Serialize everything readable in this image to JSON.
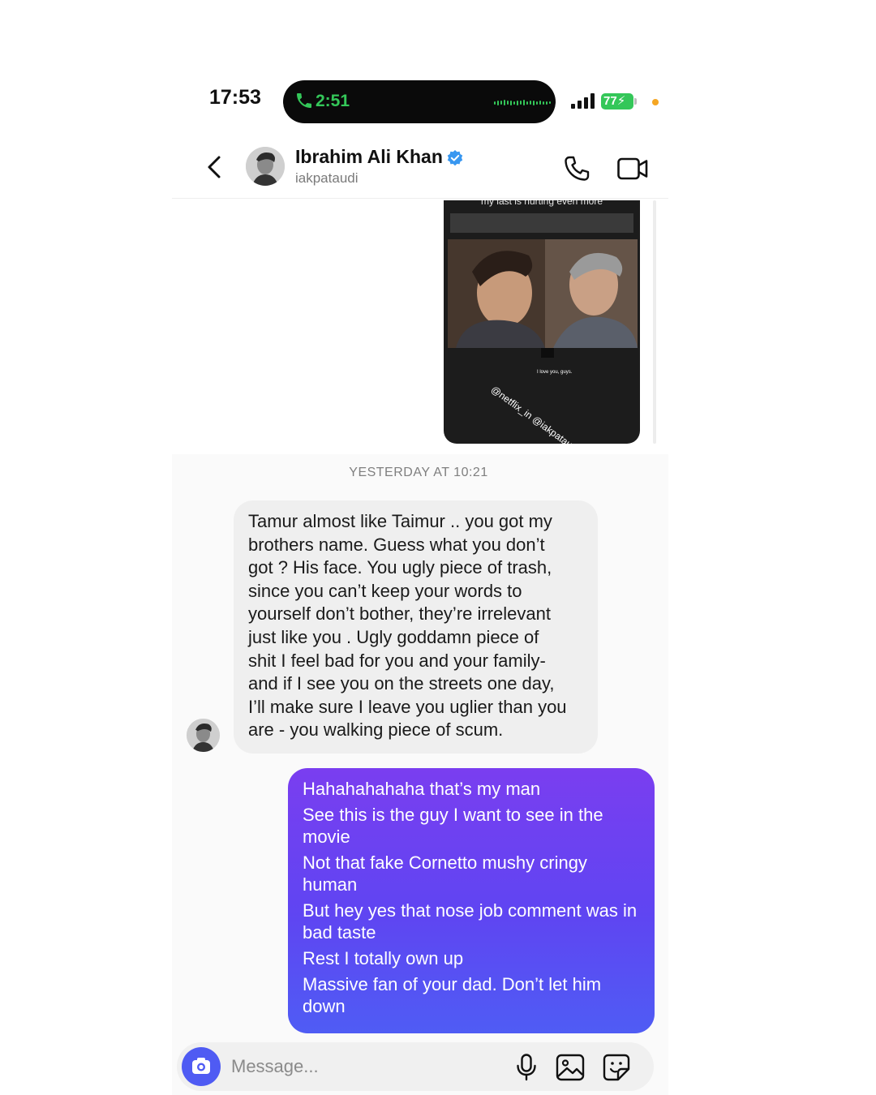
{
  "status_bar": {
    "time": "17:53",
    "call_timer": "2:51",
    "battery": "77",
    "call_color": "#34c759",
    "recording_dot_color": "#f5a623"
  },
  "header": {
    "name": "Ibrahim Ali Khan",
    "username": "iakpataudi",
    "verified": true,
    "icons": [
      "back-chevron-icon",
      "phone-icon",
      "video-camera-icon"
    ]
  },
  "shared_story": {
    "caption": "my last is hurting even more",
    "subtitle": "I love you, guys.",
    "mention": "@netflix_in @iakpataudi"
  },
  "thread": {
    "timestamp": "YESTERDAY AT 10:21",
    "incoming": {
      "lines": [
        "Tamur almost like Taimur .. you got my",
        "brothers name. Guess what you don’t",
        "got ? His face. You ugly piece of trash,",
        "since you can’t keep your words to",
        "yourself don’t bother, they’re irrelevant",
        "just like you . Ugly goddamn piece of",
        "shit I feel bad for you and your family-",
        "and if I see you on the streets one day,",
        "I’ll make sure I leave you uglier than you",
        "are - you walking piece of scum."
      ]
    },
    "outgoing": {
      "lines": [
        "Hahahahahaha that’s my man",
        "See this is the guy I want to see in the movie",
        "Not that fake Cornetto mushy cringy human",
        "But hey yes that nose job comment was in bad taste",
        "Rest I totally own up",
        "Massive fan of your dad. Don’t let him down"
      ],
      "bubble_colors": [
        "#7a3ef0",
        "#4f5cf4"
      ]
    }
  },
  "composer": {
    "placeholder": "Message...",
    "accent": "#4f5bf3",
    "icons": [
      "camera-icon",
      "microphone-icon",
      "gallery-icon",
      "sticker-icon"
    ]
  }
}
